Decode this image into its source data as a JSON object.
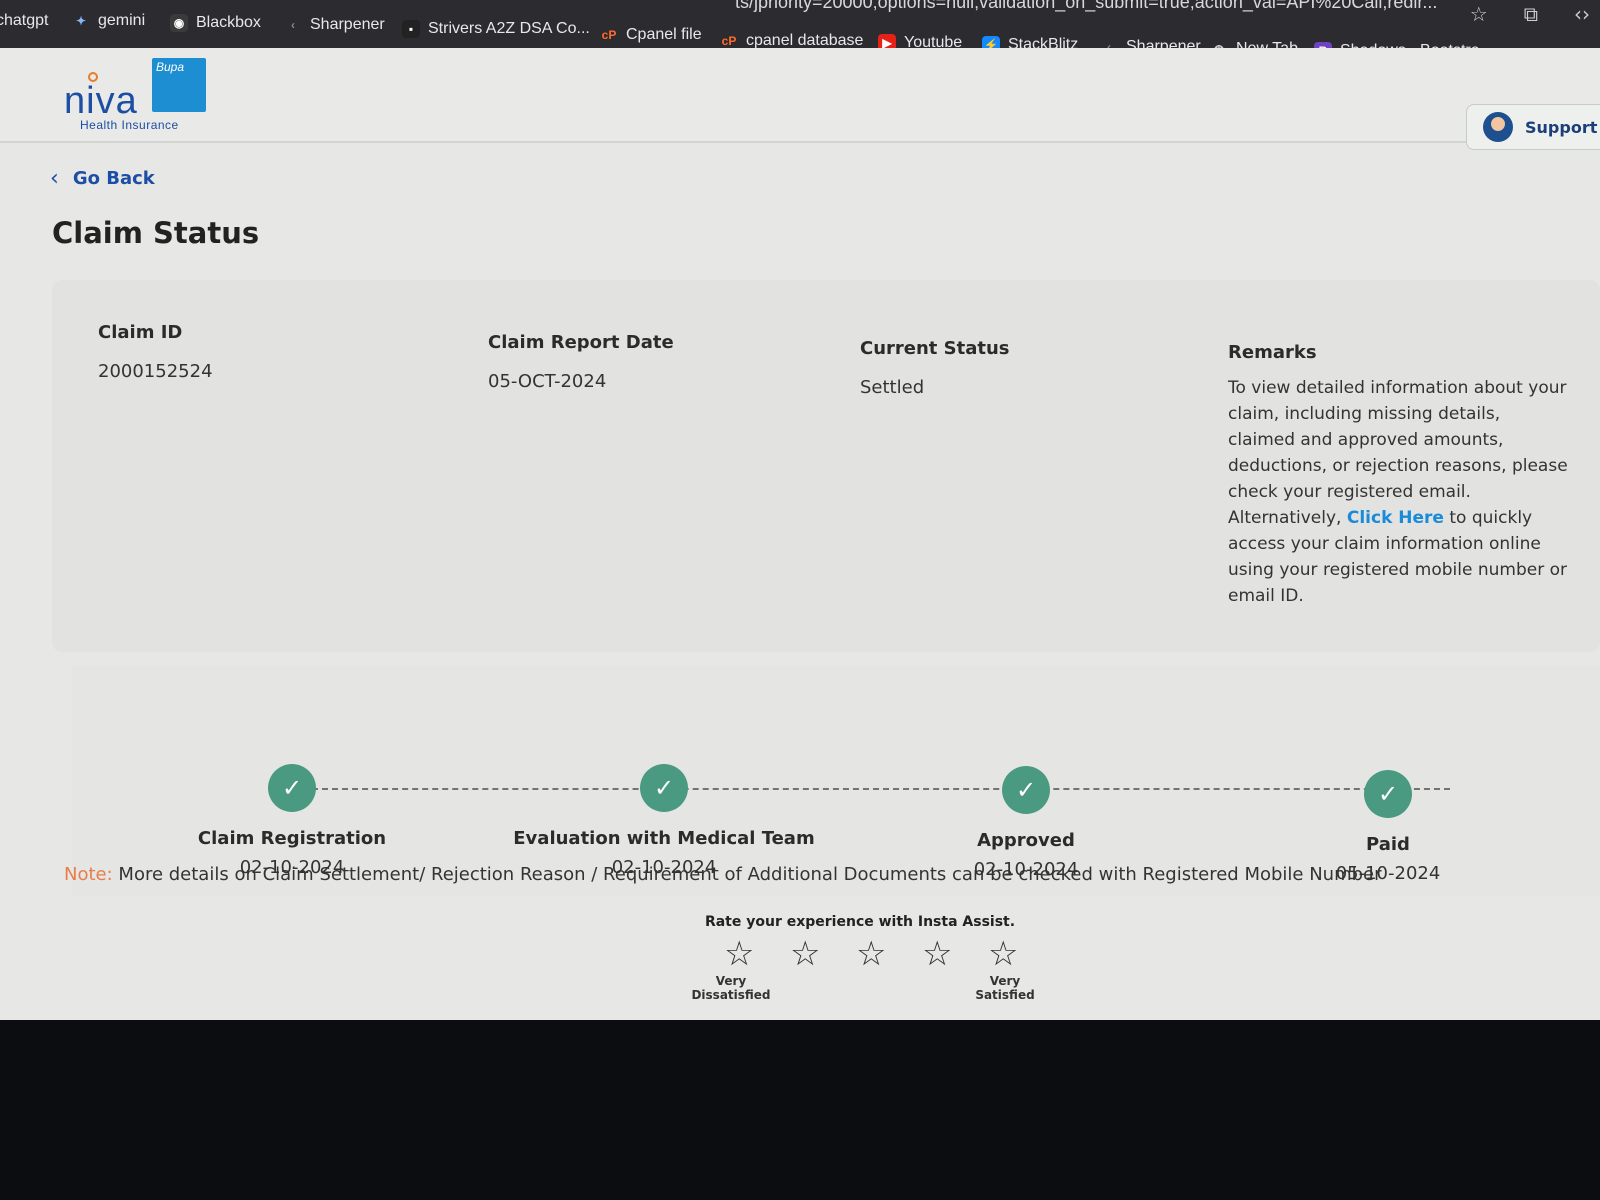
{
  "browser": {
    "url_fragment": "ts/jpriority=20000;options=null;validation_on_submit=true;action_val=API%20Call;redir...",
    "bookmarks": [
      {
        "label": "chatgpt",
        "icon": "chatgpt-icon"
      },
      {
        "label": "gemini",
        "icon": "gemini-icon"
      },
      {
        "label": "Blackbox",
        "icon": "blackbox-icon"
      },
      {
        "label": "Sharpener",
        "icon": "sharpener-icon"
      },
      {
        "label": "Strivers A2Z DSA Co...",
        "icon": "tuf-icon"
      },
      {
        "label": "Cpanel file",
        "icon": "cpanel-icon"
      },
      {
        "label": "cpanel database",
        "icon": "cpanel-icon"
      },
      {
        "label": "Youtube",
        "icon": "youtube-icon"
      },
      {
        "label": "StackBlitz",
        "icon": "stackblitz-icon"
      },
      {
        "label": "Sharpener",
        "icon": "sharpener-icon"
      },
      {
        "label": "New Tab",
        "icon": "globe-icon"
      },
      {
        "label": "Shadows · Bootstra...",
        "icon": "bootstrap-icon"
      }
    ]
  },
  "header": {
    "logo_word": "niva",
    "logo_badge": "Bupa",
    "logo_sub": "Health Insurance",
    "support_label": "Support"
  },
  "nav": {
    "go_back": "Go Back"
  },
  "page_title": "Claim Status",
  "claim": {
    "id_label": "Claim ID",
    "id_value": "2000152524",
    "report_date_label": "Claim Report Date",
    "report_date_value": "05-OCT-2024",
    "status_label": "Current Status",
    "status_value": "Settled",
    "remarks_label": "Remarks",
    "remarks_part1": "To view detailed information about your claim, including missing details, claimed and approved amounts, deductions, or rejection reasons, please check your registered email. Alternatively, ",
    "remarks_link": "Click Here",
    "remarks_part2": " to quickly access your claim information online using your registered mobile number or email ID."
  },
  "timeline": [
    {
      "name": "Claim Registration",
      "date": "02-10-2024"
    },
    {
      "name": "Evaluation with Medical Team",
      "date": "02-10-2024"
    },
    {
      "name": "Approved",
      "date": "02-10-2024"
    },
    {
      "name": "Paid",
      "date": "05-10-2024"
    }
  ],
  "note": {
    "label": "Note:",
    "text": " More details on Claim Settlement/ Rejection Reason / Requirement of Additional Documents can be checked with Registered Mobile Number"
  },
  "rating": {
    "question": "Rate your experience with Insta Assist.",
    "low_label": "Very Dissatisfied",
    "high_label": "Very Satisfied",
    "star_glyph": "☆"
  },
  "colors": {
    "brand_blue": "#1b4ea4",
    "link_blue": "#1a8bd8",
    "step_green": "#4a9a82",
    "note_orange": "#e87d4a"
  }
}
